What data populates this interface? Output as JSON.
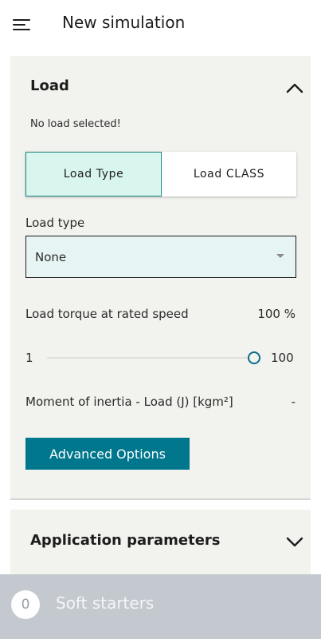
{
  "header": {
    "menu_icon": "hamburger-menu-icon",
    "title": "New simulation"
  },
  "load_panel": {
    "title": "Load",
    "expanded": true,
    "status_text": "No load selected!",
    "tabs": [
      {
        "label": "Load Type",
        "active": true
      },
      {
        "label": "Load CLASS",
        "active": false
      }
    ],
    "load_type": {
      "label": "Load type",
      "selected": "None"
    },
    "torque": {
      "label": "Load torque at rated speed",
      "value": "100 %",
      "slider_min": "1",
      "slider_max": "100",
      "slider_fraction": 1.0
    },
    "inertia": {
      "label": "Moment of inertia - Load (J) [kgm²]",
      "value": "-"
    },
    "advanced_button": "Advanced Options"
  },
  "application_panel": {
    "title": "Application parameters",
    "expanded": false
  },
  "bottom_bar": {
    "count": "0",
    "label": "Soft starters"
  },
  "colors": {
    "accent": "#00778d",
    "panel_bg": "#f2f2ee",
    "active_tab_bg": "#d9f6ee",
    "bottom_bar_bg": "#c4c9cf"
  }
}
